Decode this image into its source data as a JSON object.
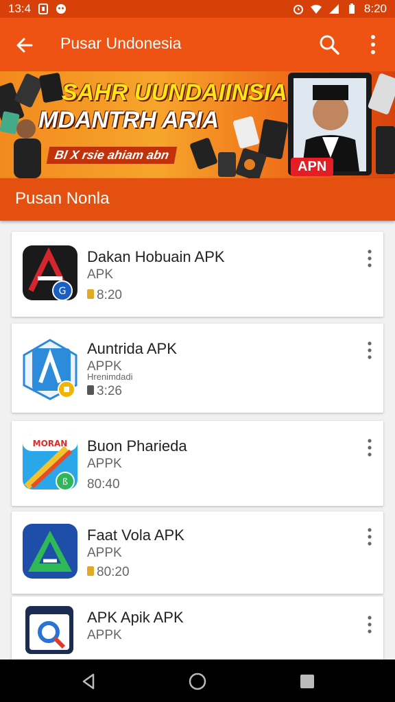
{
  "status_bar": {
    "time": "13:4",
    "battery": "8:20"
  },
  "app_bar": {
    "title": "Pusar Undonesia"
  },
  "banner": {
    "headline1": "SAHR UUNDAIINSIA",
    "headline2": "MDANTRH ARIA",
    "tagline": "Bl X rsie ahiam abn",
    "badge": "APN"
  },
  "section": {
    "title": "Pusan Nonla"
  },
  "apps": [
    {
      "name": "Dakan Hobuain APK",
      "sub": "APK",
      "extra": "",
      "time": "8:20"
    },
    {
      "name": "Auntrida APK",
      "sub": "APPK",
      "extra": "Hrenimdadi",
      "time": "3:26"
    },
    {
      "name": "Buon Pharieda",
      "sub": "APPK",
      "extra": "",
      "time": "80:40"
    },
    {
      "name": "Faat Vola APK",
      "sub": "APPK",
      "extra": "",
      "time": "80:20"
    },
    {
      "name": "APK Apik APK",
      "sub": "APPK",
      "extra": "",
      "time": ""
    }
  ]
}
